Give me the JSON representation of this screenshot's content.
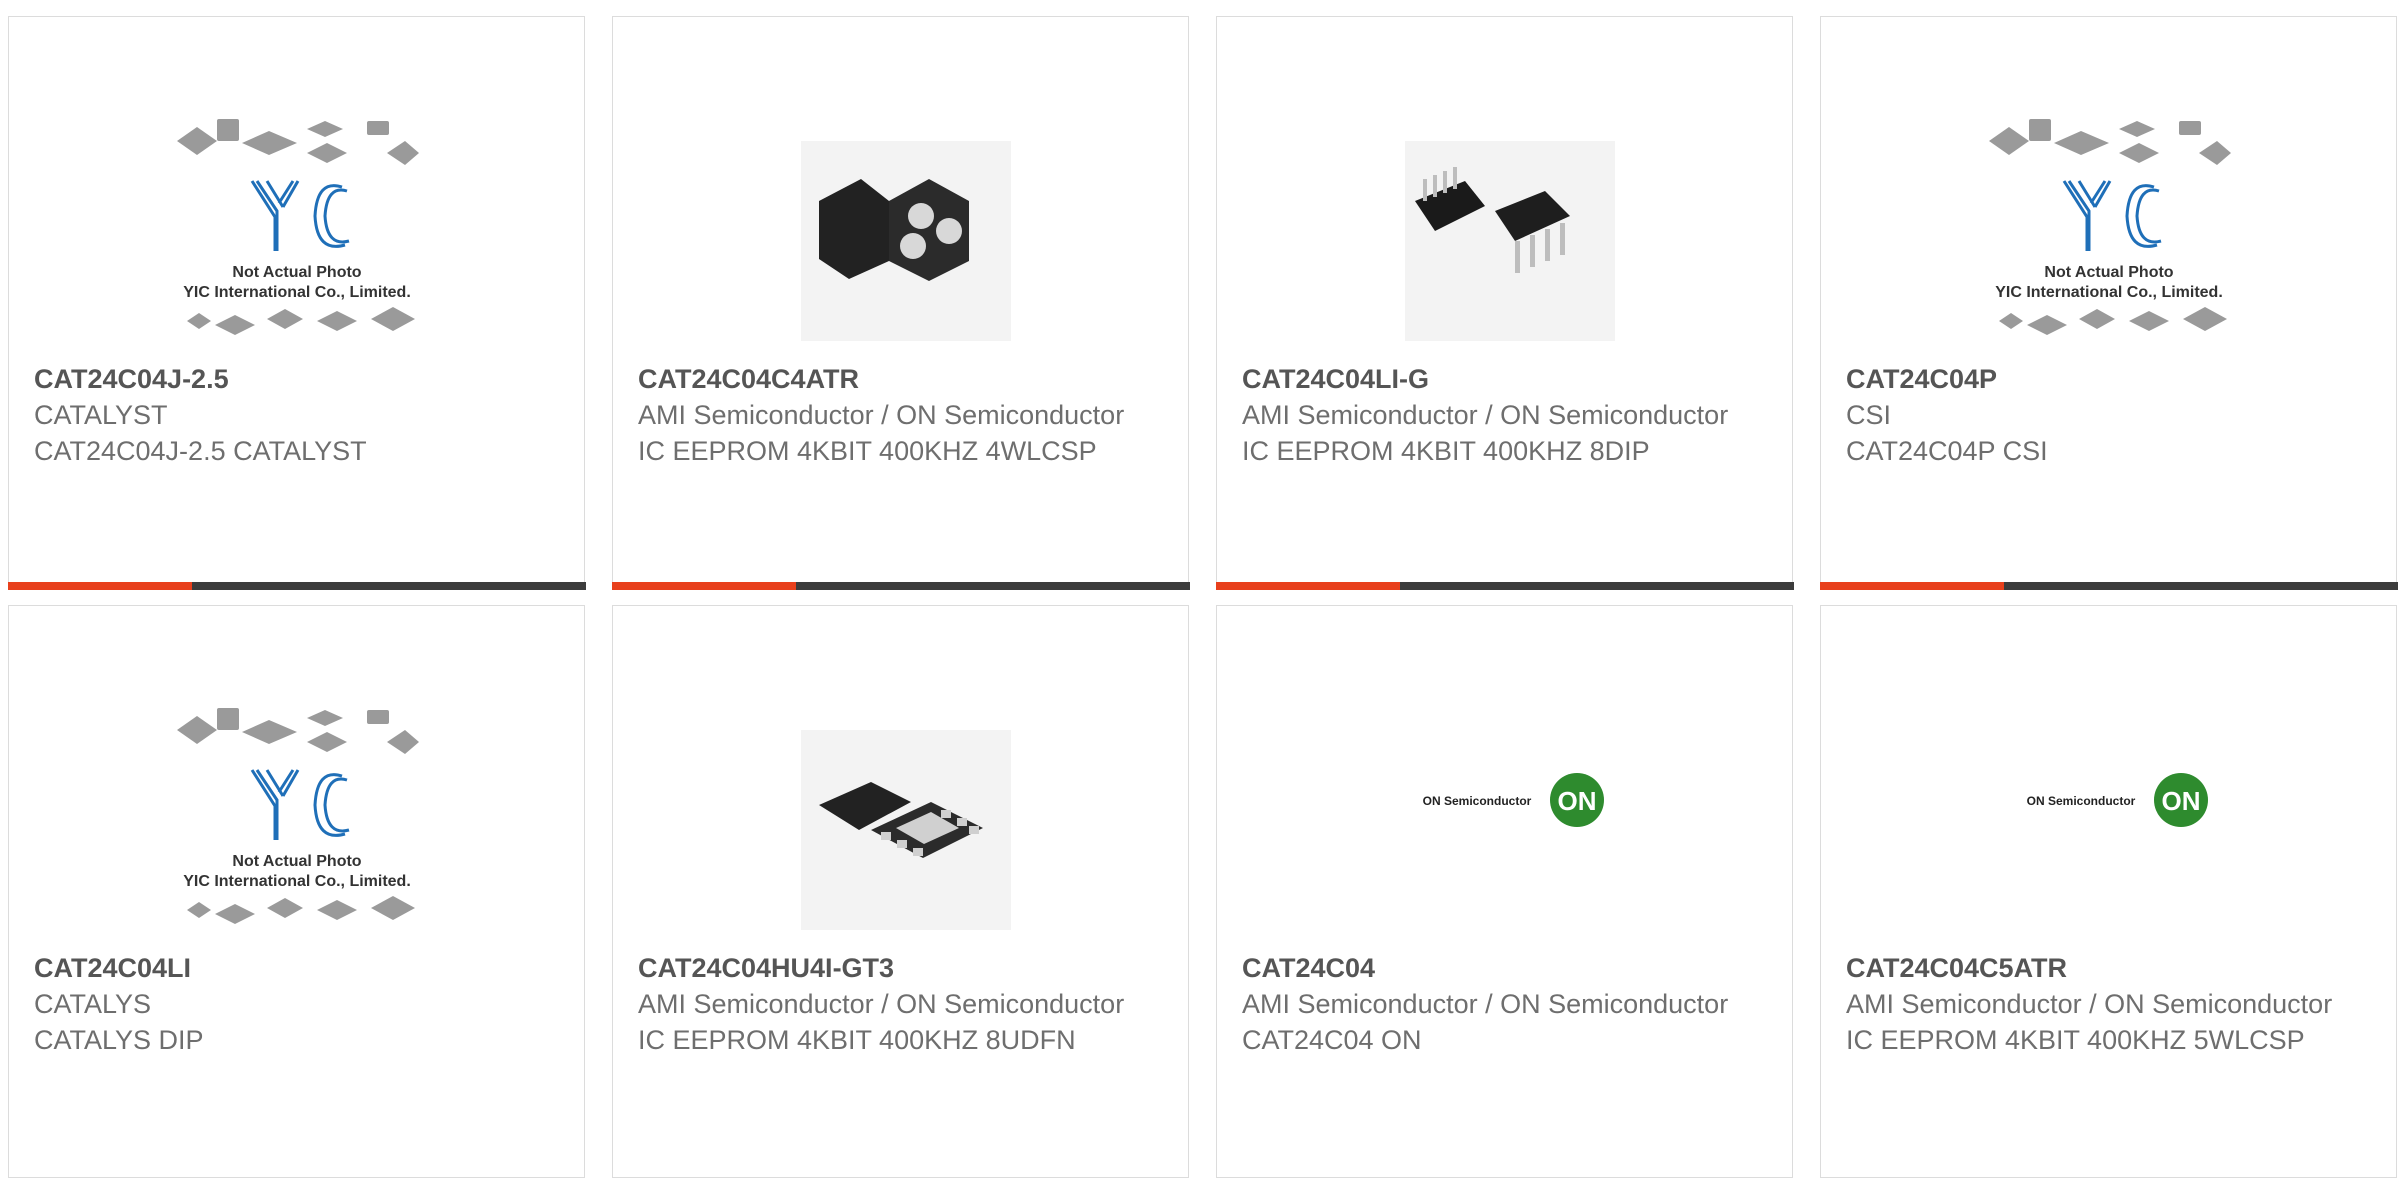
{
  "colors": {
    "accent": "#e8401c",
    "bar": "#3c3c3c",
    "text_strong": "#555555",
    "text": "#6e6e6e",
    "yic_blue": "#1f6fb8",
    "on_green": "#2e8b2e"
  },
  "placeholder": {
    "line1": "Not Actual Photo",
    "line2": "YIC International Co., Limited."
  },
  "on_logo": {
    "wordmark": "ON Semiconductor",
    "badge": "ON"
  },
  "products": [
    {
      "part_number": "CAT24C04J-2.5",
      "manufacturer": "CATALYST",
      "description": "CAT24C04J-2.5 CATALYST",
      "image": "yic-placeholder"
    },
    {
      "part_number": "CAT24C04C4ATR",
      "manufacturer": "AMI Semiconductor / ON Semiconductor",
      "description": "IC EEPROM 4KBIT 400KHZ 4WLCSP",
      "image": "wlcsp-chip"
    },
    {
      "part_number": "CAT24C04LI-G",
      "manufacturer": "AMI Semiconductor / ON Semiconductor",
      "description": "IC EEPROM 4KBIT 400KHZ 8DIP",
      "image": "dip-chip"
    },
    {
      "part_number": "CAT24C04P",
      "manufacturer": "CSI",
      "description": "CAT24C04P CSI",
      "image": "yic-placeholder"
    },
    {
      "part_number": "CAT24C04LI",
      "manufacturer": "CATALYS",
      "description": "CATALYS DIP",
      "image": "yic-placeholder"
    },
    {
      "part_number": "CAT24C04HU4I-GT3",
      "manufacturer": "AMI Semiconductor / ON Semiconductor",
      "description": "IC EEPROM 4KBIT 400KHZ 8UDFN",
      "image": "udfn-chip"
    },
    {
      "part_number": "CAT24C04",
      "manufacturer": "AMI Semiconductor / ON Semiconductor",
      "description": "CAT24C04 ON",
      "image": "on-logo"
    },
    {
      "part_number": "CAT24C04C5ATR",
      "manufacturer": "AMI Semiconductor / ON Semiconductor",
      "description": "IC EEPROM 4KBIT 400KHZ 5WLCSP",
      "image": "on-logo"
    }
  ]
}
